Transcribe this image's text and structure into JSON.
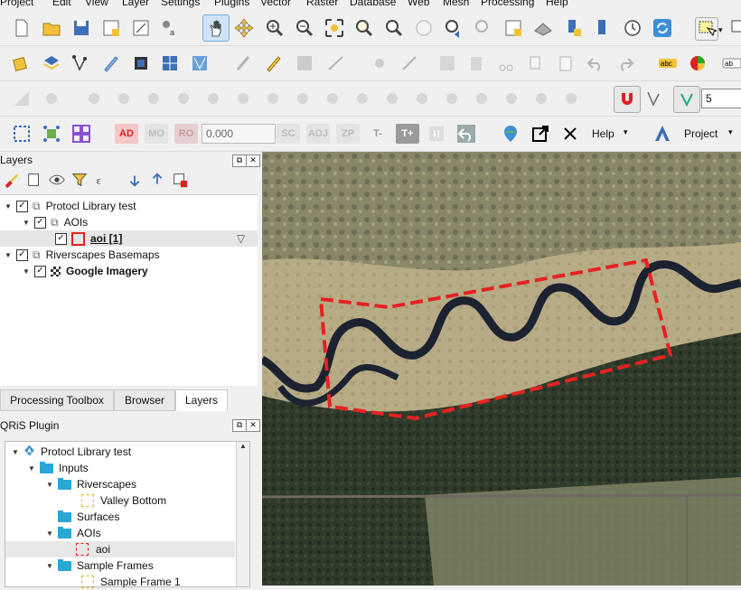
{
  "menu": [
    "Project",
    "Edit",
    "View",
    "Layer",
    "Settings",
    "Plugins",
    "Vector",
    "Raster",
    "Database",
    "Web",
    "Mesh",
    "Processing",
    "Help"
  ],
  "toolbar4": {
    "ad": "AD",
    "mo": "MO",
    "ro": "RO",
    "coord_value": "0.000",
    "sc": "SC",
    "adj": "ADJ",
    "zp": "ZP",
    "t_minus": "T-",
    "t_plus": "T+",
    "help_label": "Help",
    "project_label": "Project"
  },
  "toolbar3": {
    "snap_tolerance": "5"
  },
  "layers_panel": {
    "title": "Layers",
    "items": [
      {
        "label": "Protocl Library test"
      },
      {
        "label": "AOIs"
      },
      {
        "label": "aoi [1]"
      },
      {
        "label": "Riverscapes Basemaps"
      },
      {
        "label": "Google Imagery"
      }
    ]
  },
  "tabs": [
    "Processing Toolbox",
    "Browser",
    "Layers"
  ],
  "qris_panel": {
    "title": "QRiS Plugin",
    "items": [
      {
        "label": "Protocl Library test"
      },
      {
        "label": "Inputs"
      },
      {
        "label": "Riverscapes"
      },
      {
        "label": "Valley Bottom"
      },
      {
        "label": "Surfaces"
      },
      {
        "label": "AOIs"
      },
      {
        "label": "aoi"
      },
      {
        "label": "Sample Frames"
      },
      {
        "label": "Sample Frame 1"
      }
    ]
  },
  "colors": {
    "aoi_outline": "#e52222",
    "accent": "#2aa6d8"
  }
}
